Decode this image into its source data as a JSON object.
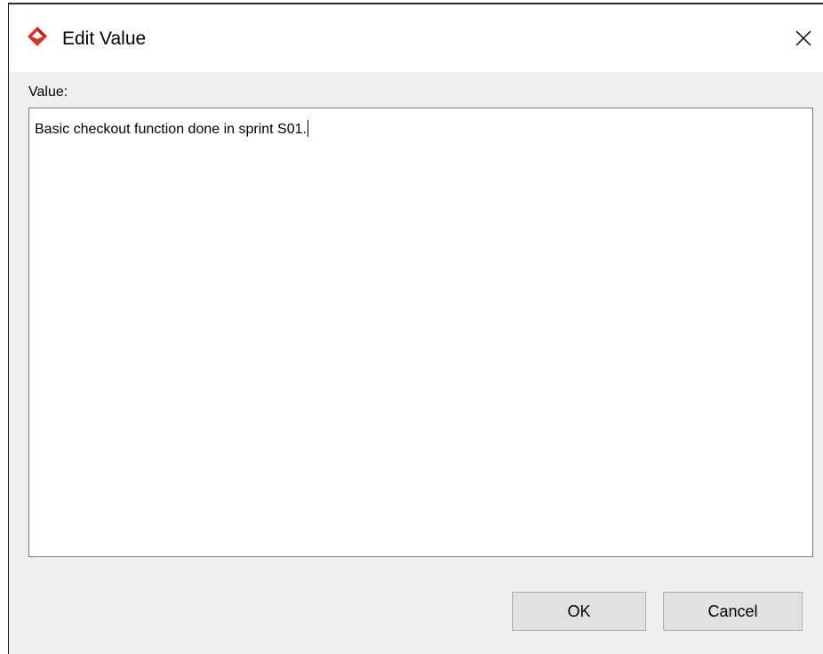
{
  "window": {
    "title": "Edit Value",
    "app_icon": "visual-paradigm-logo-icon",
    "close_icon": "close-icon"
  },
  "form": {
    "label": "Value:",
    "value": "Basic checkout function done in sprint S01."
  },
  "buttons": {
    "ok_label": "OK",
    "cancel_label": "Cancel"
  },
  "colors": {
    "dialog_bg": "#f0f0f0",
    "titlebar_bg": "#ffffff",
    "icon_red": "#d9342b",
    "button_bg": "#e1e1e1"
  }
}
